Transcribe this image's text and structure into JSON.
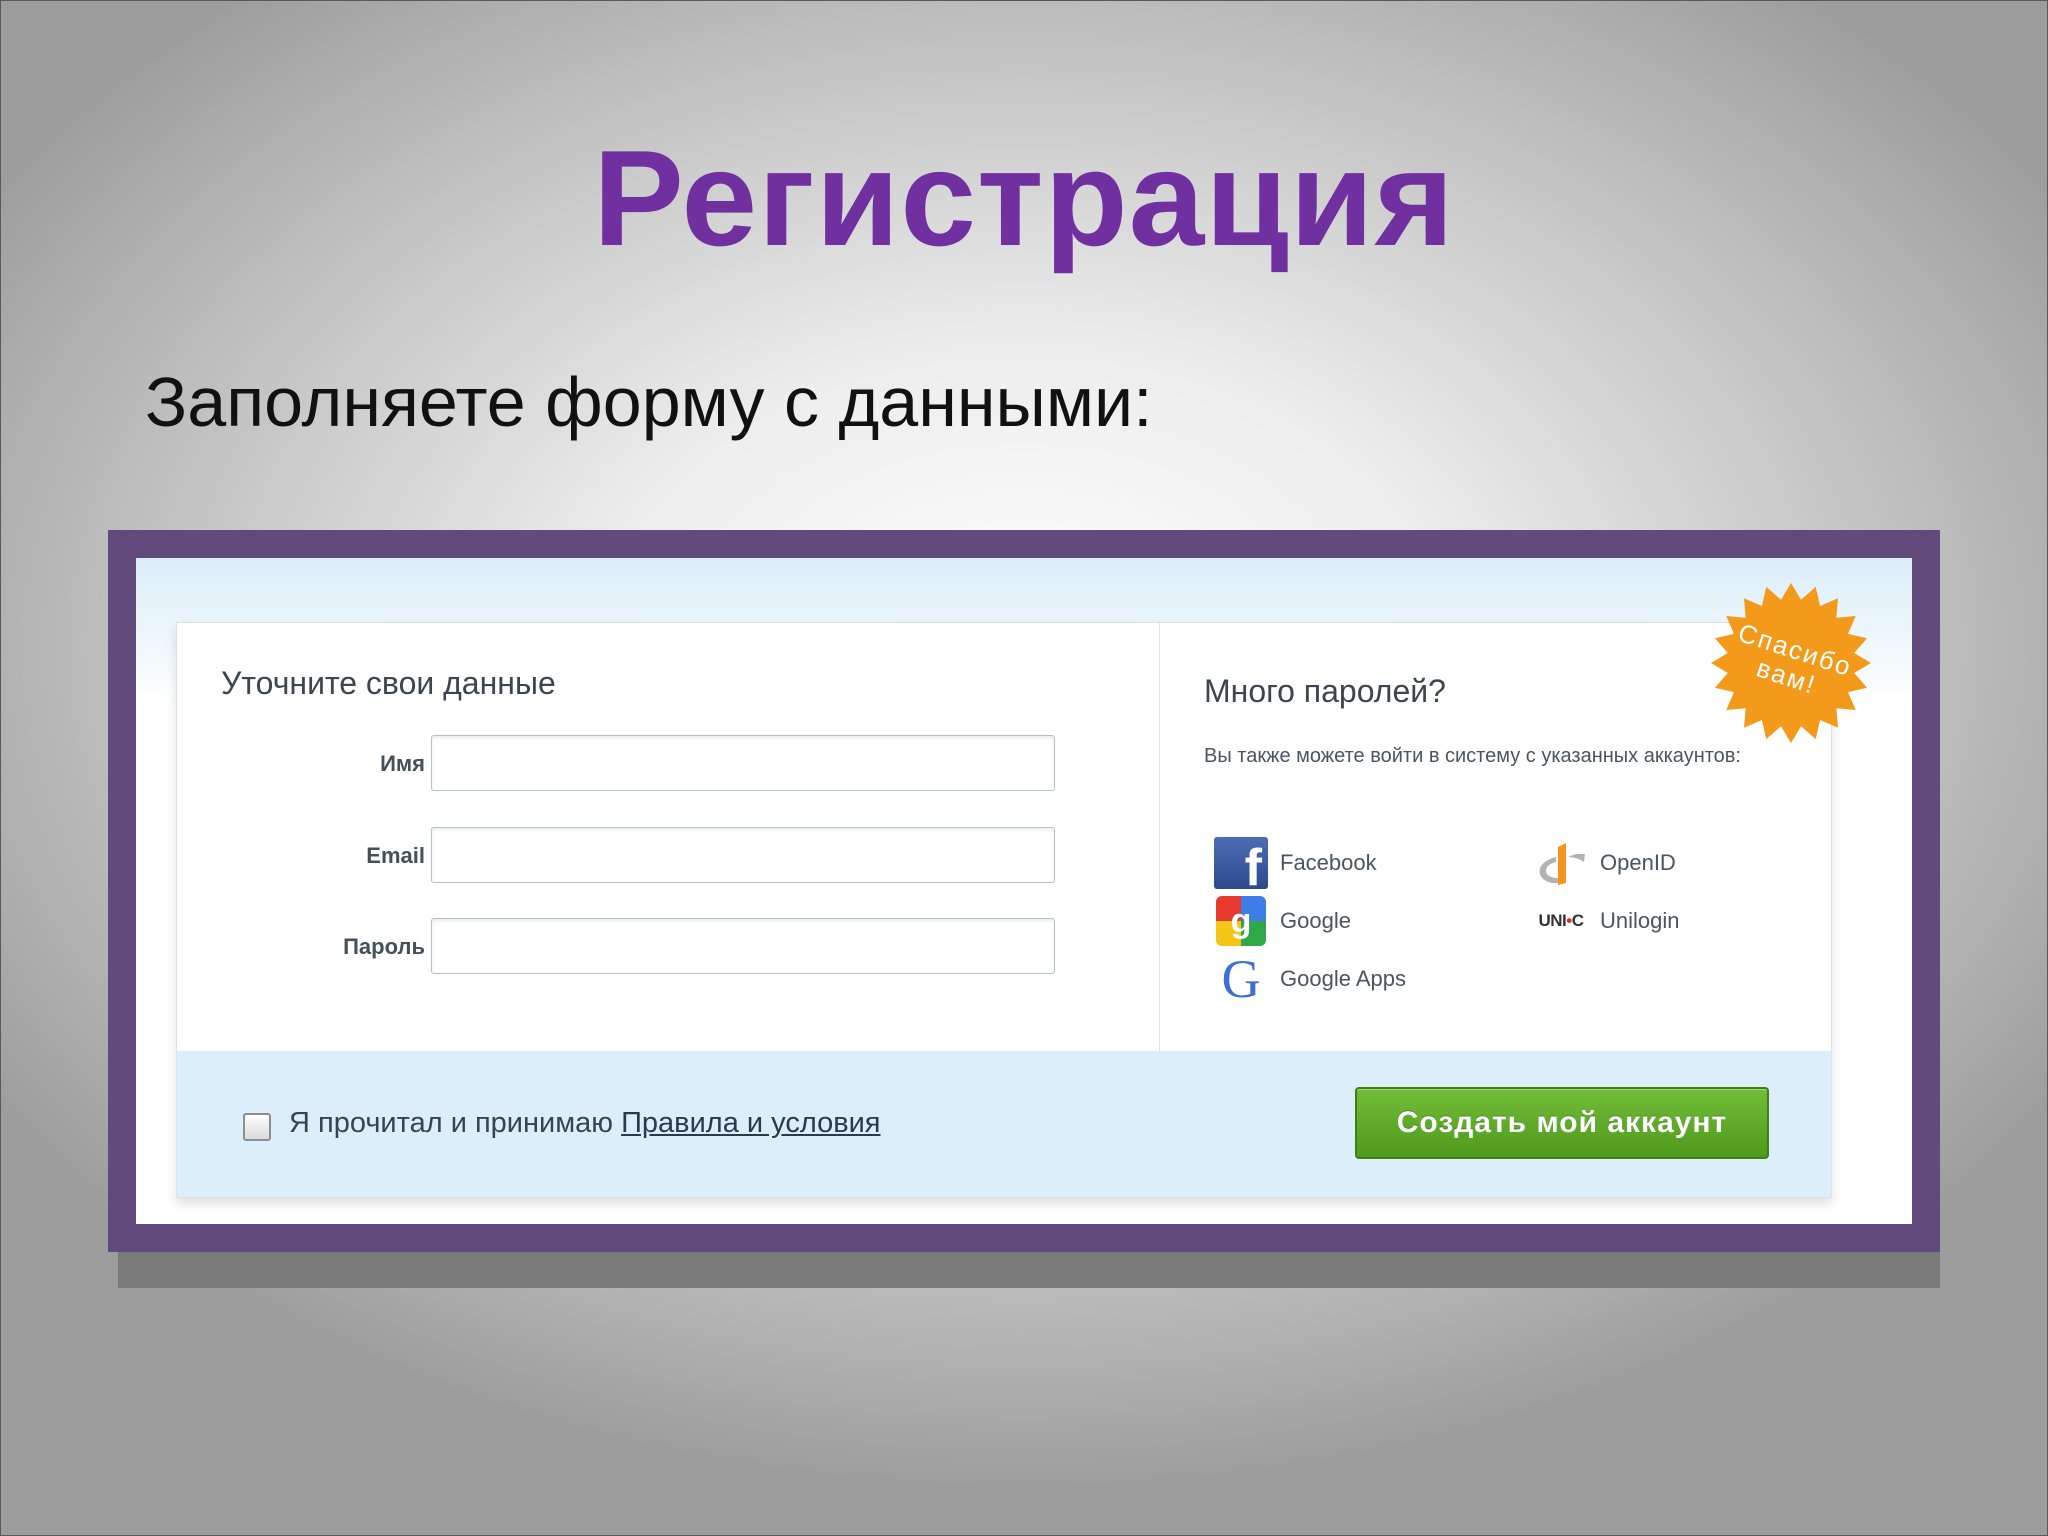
{
  "slide": {
    "title": "Регистрация",
    "subtitle": "Заполняете форму с данными:"
  },
  "form": {
    "heading": "Уточните свои данные",
    "fields": [
      {
        "label": "Имя",
        "value": ""
      },
      {
        "label": "Email",
        "value": ""
      },
      {
        "label": "Пароль",
        "value": ""
      }
    ]
  },
  "social": {
    "heading": "Много паролей?",
    "helper": "Вы также можете войти в систему с указанных аккаунтов:",
    "providers": [
      {
        "label": "Facebook",
        "icon": "facebook-icon"
      },
      {
        "label": "Google",
        "icon": "google-icon"
      },
      {
        "label": "Google Apps",
        "icon": "google-apps-icon"
      },
      {
        "label": "OpenID",
        "icon": "openid-icon"
      },
      {
        "label": "Unilogin",
        "icon": "unilogin-icon",
        "icon_text": "UNI",
        "icon_text_dot": "•",
        "icon_text_end": "C"
      }
    ]
  },
  "badge": {
    "line1": "Спасибо",
    "line2": "вам!",
    "color": "#f39a1b"
  },
  "footer": {
    "agree_prefix": "Я прочитал и принимаю ",
    "agree_link": "Правила и условия",
    "checkbox_checked": false,
    "create_button": "Создать мой аккаунт"
  },
  "colors": {
    "title": "#7030a0",
    "frame": "#614a7c",
    "button": "#5aa824"
  }
}
